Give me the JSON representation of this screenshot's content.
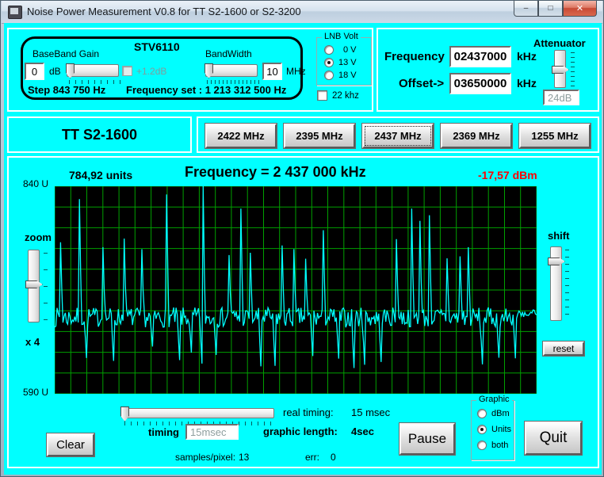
{
  "window": {
    "title": "Noise Power Measurement V0.8 for TT S2-1600 or S2-3200",
    "minimize_glyph": "–",
    "maximize_glyph": "□",
    "close_glyph": "✕"
  },
  "tuner_box": {
    "chip_label": "STV6110",
    "baseband": {
      "label": "BaseBand Gain",
      "value": "0",
      "unit": "dB",
      "boost_label": "+1.2dB"
    },
    "bandwidth": {
      "label": "BandWidth",
      "value": "10",
      "unit": "MHz"
    },
    "step_text": "Step 843 750 Hz",
    "freq_set_text": "Frequency set : 1 213 312 500 Hz"
  },
  "lnb": {
    "label": "LNB Volt",
    "options": [
      "0 V",
      "13 V",
      "18 V"
    ],
    "selected": "13 V"
  },
  "tone": {
    "label": "22 khz",
    "checked": false
  },
  "freq_box": {
    "frequency_label": "Frequency",
    "frequency_value": "02437000",
    "frequency_unit": "kHz",
    "offset_label": "Offset->",
    "offset_value": "03650000",
    "offset_unit": "kHz",
    "attenuator_label": "Attenuator",
    "attenuator_value": "24dB"
  },
  "device": {
    "label": "TT S2-1600"
  },
  "presets": {
    "buttons": [
      "2422 MHz",
      "2395 MHz",
      "2437 MHz",
      "2369 MHz",
      "1255 MHz"
    ],
    "active": "2437 MHz"
  },
  "graph": {
    "units_value": "784,92 units",
    "freq_title": "Frequency =  2 437 000 kHz",
    "dbm_value": "-17,57 dBm",
    "y_top": "840 U",
    "y_bottom": "590 U",
    "zoom_label": "zoom",
    "zoom_factor": "x 4",
    "shift_label": "shift",
    "reset_label": "reset"
  },
  "chart_data": {
    "type": "line",
    "title": "Frequency =  2 437 000 kHz",
    "ylabel": "Units",
    "ylim": [
      590,
      840
    ],
    "y_axis_labels": [
      "840 U",
      "590 U"
    ],
    "current_units": 784.92,
    "current_dbm": -17.57,
    "grid": {
      "cols": 30,
      "rows": 10,
      "color": "#00A000",
      "on": true
    },
    "line_color": "#00FFFF",
    "plot_bg": "#000000",
    "description": "Live noise-power waveform: dense noise band around ~682 units with periodic spikes up to ~835 units and dips to ~620 units; one spike clipped at the top edge near 30% of the width.",
    "synth": {
      "seed": 7,
      "points": 410,
      "baseline": 682,
      "noise_amp": 12,
      "spike_up_min": 70,
      "spike_up_max": 150,
      "spike_down_min": 35,
      "spike_down_max": 62,
      "spike_gap_min": 9,
      "spike_gap_max": 23,
      "mega_spike_x": 188
    }
  },
  "controls": {
    "clear": "Clear",
    "pause": "Pause",
    "quit": "Quit",
    "timing_label": "timing",
    "timing_value": "15msec",
    "real_timing_label": "real timing:",
    "real_timing_value": "15 msec",
    "graphic_length_label": "graphic length:",
    "graphic_length_value": "4sec",
    "samples_label": "samples/pixel:",
    "samples_value": "13",
    "err_label": "err:",
    "err_value": "0"
  },
  "graphic_group": {
    "label": "Graphic",
    "options": [
      "dBm",
      "Units",
      "both"
    ],
    "selected": "Units"
  },
  "colors": {
    "background": "#00FFFF",
    "grid": "#00A000",
    "signal": "#00FFFF",
    "alert": "#FF0000",
    "plot_bg": "#000000",
    "panel_border": "#FFFFFF"
  }
}
